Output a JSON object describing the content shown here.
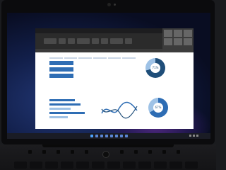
{
  "spreadsheet": {
    "table": {
      "row_labels": [
        "",
        "",
        ""
      ],
      "rows": [
        [
          "",
          "",
          "",
          "",
          ""
        ],
        [
          "",
          "",
          "",
          "",
          ""
        ],
        [
          "",
          "",
          "",
          "",
          ""
        ]
      ]
    },
    "donut_top": {
      "percent_label": "71%"
    },
    "donut_bottom": {
      "percent_label": "67%"
    }
  },
  "colors": {
    "accent": "#2e6db4",
    "dark_accent": "#1f4e79",
    "light_accent": "#9ec2e6"
  }
}
